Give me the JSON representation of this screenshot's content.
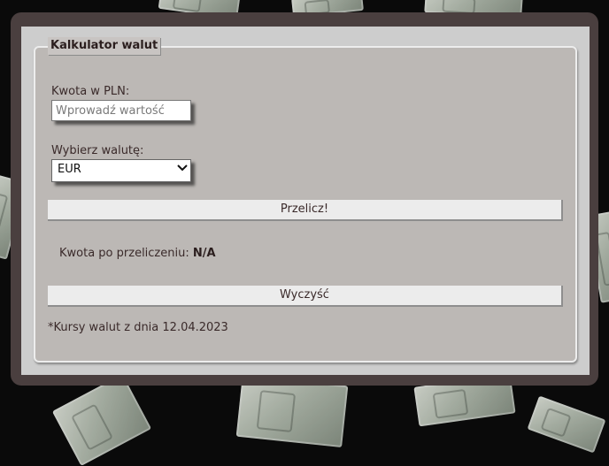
{
  "calculator": {
    "legend": "Kalkulator walut",
    "amount_label": "Kwota w PLN:",
    "amount_placeholder": "Wprowadź wartość",
    "amount_value": "",
    "currency_label": "Wybierz walutę:",
    "currency_selected": "EUR",
    "convert_label": "Przelicz!",
    "result_label": "Kwota po przeliczeniu:",
    "result_value": "N/A",
    "clear_label": "Wyczyść",
    "footnote": "*Kursy walut z dnia 12.04.2023"
  },
  "icons": {
    "select_chevron": "chevron-down-icon"
  }
}
